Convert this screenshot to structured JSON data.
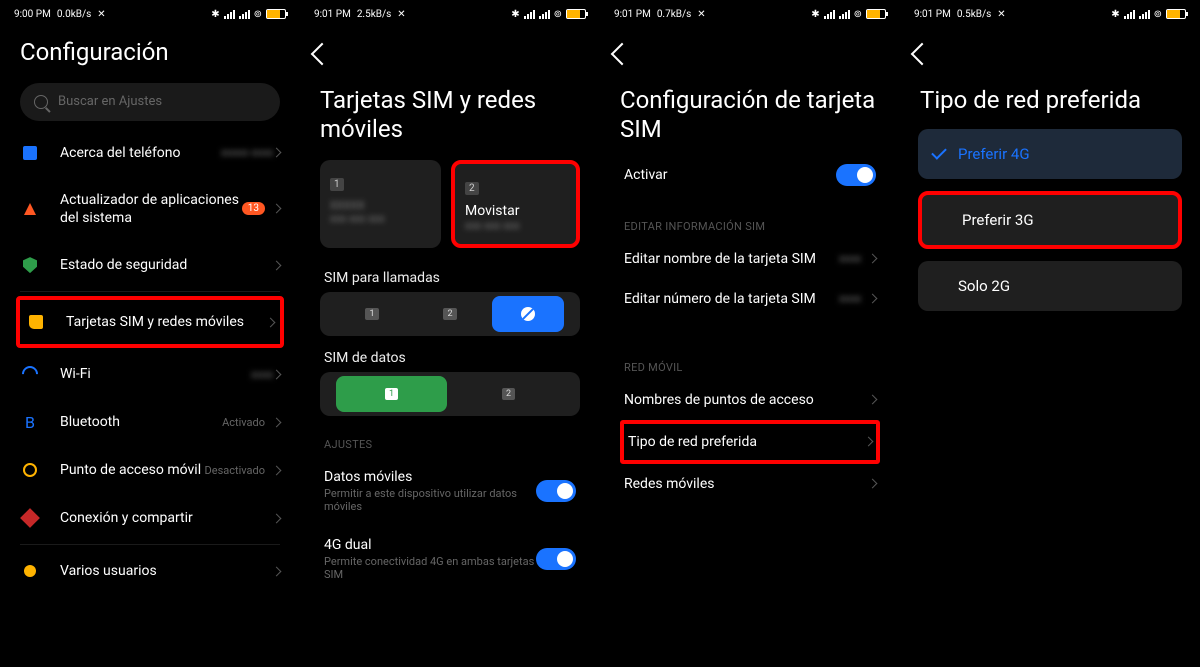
{
  "panel1": {
    "time": "9:00 PM",
    "net": "0.0kB/s",
    "title": "Configuración",
    "search_placeholder": "Buscar en Ajustes",
    "items": [
      {
        "label": "Acerca del teléfono",
        "sub": ""
      },
      {
        "label": "Actualizador de aplicaciones del sistema",
        "badge": "13"
      },
      {
        "label": "Estado de seguridad"
      },
      {
        "label": "Tarjetas SIM y redes móviles",
        "hl": true
      },
      {
        "label": "Wi-Fi"
      },
      {
        "label": "Bluetooth",
        "status": "Activado"
      },
      {
        "label": "Punto de acceso móvil",
        "status": "Desactivado"
      },
      {
        "label": "Conexión y compartir"
      },
      {
        "label": "Varios usuarios"
      }
    ]
  },
  "panel2": {
    "time": "9:01 PM",
    "net": "2.5kB/s",
    "title": "Tarjetas SIM y redes móviles",
    "sim1": {
      "num": "1",
      "name": ""
    },
    "sim2": {
      "num": "2",
      "name": "Movistar"
    },
    "calls_label": "SIM para llamadas",
    "data_label": "SIM de datos",
    "settings_header": "AJUSTES",
    "mobile_data": {
      "t": "Datos móviles",
      "s": "Permitir a este dispositivo utilizar datos móviles"
    },
    "dual4g": {
      "t": "4G dual",
      "s": "Permite conectividad 4G en ambas tarjetas SIM"
    }
  },
  "panel3": {
    "time": "9:01 PM",
    "net": "0.7kB/s",
    "title": "Configuración de tarjeta SIM",
    "activate": "Activar",
    "edit_header": "EDITAR INFORMACIÓN SIM",
    "edit_name": "Editar nombre de la tarjeta SIM",
    "edit_number": "Editar número de la tarjeta SIM",
    "net_header": "RED MÓVIL",
    "apn": "Nombres de puntos de acceso",
    "net_type": "Tipo de red preferida",
    "mobile_nets": "Redes móviles"
  },
  "panel4": {
    "time": "9:01 PM",
    "net": "0.5kB/s",
    "title": "Tipo de red preferida",
    "opts": [
      "Preferir 4G",
      "Preferir 3G",
      "Solo 2G"
    ]
  }
}
